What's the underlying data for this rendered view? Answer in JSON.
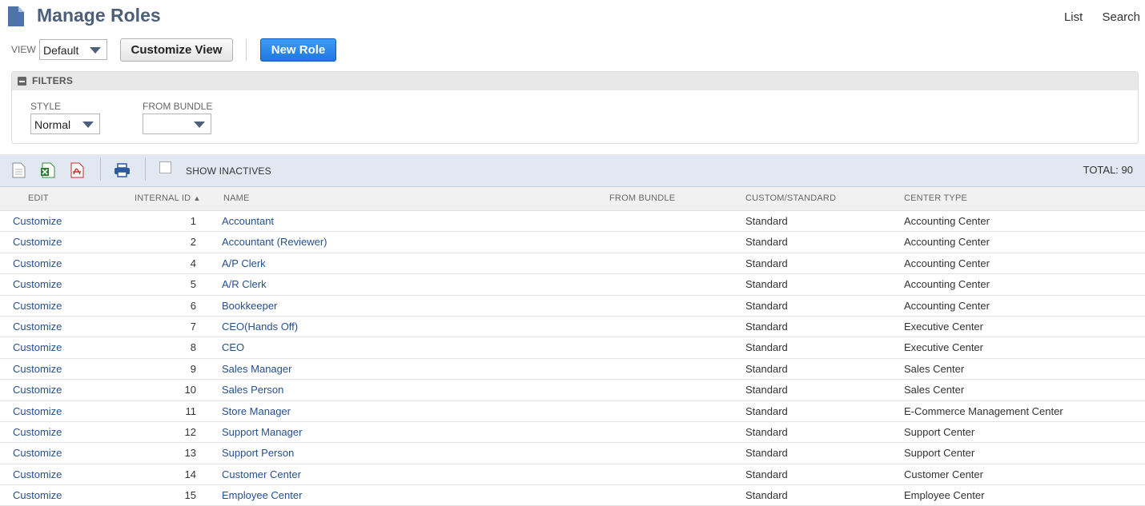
{
  "header": {
    "title": "Manage Roles",
    "links": [
      "List",
      "Search"
    ]
  },
  "controls": {
    "view_label": "VIEW",
    "view_value": "Default",
    "customize_view_label": "Customize View",
    "new_role_label": "New Role"
  },
  "filters": {
    "title": "FILTERS",
    "style_label": "STYLE",
    "style_value": "Normal",
    "from_bundle_label": "FROM BUNDLE",
    "from_bundle_value": ""
  },
  "toolbar": {
    "show_inactives_label": "SHOW INACTIVES",
    "show_inactives_checked": false,
    "total": "TOTAL: 90"
  },
  "table": {
    "headers": {
      "edit": "EDIT",
      "internal_id": "INTERNAL ID",
      "name": "NAME",
      "from_bundle": "FROM BUNDLE",
      "custom_standard": "CUSTOM/STANDARD",
      "center_type": "CENTER TYPE"
    },
    "sort_indicator": "▲",
    "rows": [
      {
        "edit": "Customize",
        "id": "1",
        "name": "Accountant",
        "type": "Standard",
        "center": "Accounting Center"
      },
      {
        "edit": "Customize",
        "id": "2",
        "name": "Accountant (Reviewer)",
        "type": "Standard",
        "center": "Accounting Center"
      },
      {
        "edit": "Customize",
        "id": "4",
        "name": "A/P Clerk",
        "type": "Standard",
        "center": "Accounting Center"
      },
      {
        "edit": "Customize",
        "id": "5",
        "name": "A/R Clerk",
        "type": "Standard",
        "center": "Accounting Center"
      },
      {
        "edit": "Customize",
        "id": "6",
        "name": "Bookkeeper",
        "type": "Standard",
        "center": "Accounting Center"
      },
      {
        "edit": "Customize",
        "id": "7",
        "name": "CEO(Hands Off)",
        "type": "Standard",
        "center": "Executive Center"
      },
      {
        "edit": "Customize",
        "id": "8",
        "name": "CEO",
        "type": "Standard",
        "center": "Executive Center"
      },
      {
        "edit": "Customize",
        "id": "9",
        "name": "Sales Manager",
        "type": "Standard",
        "center": "Sales Center"
      },
      {
        "edit": "Customize",
        "id": "10",
        "name": "Sales Person",
        "type": "Standard",
        "center": "Sales Center"
      },
      {
        "edit": "Customize",
        "id": "11",
        "name": "Store Manager",
        "type": "Standard",
        "center": "E-Commerce Management Center"
      },
      {
        "edit": "Customize",
        "id": "12",
        "name": "Support Manager",
        "type": "Standard",
        "center": "Support Center"
      },
      {
        "edit": "Customize",
        "id": "13",
        "name": "Support Person",
        "type": "Standard",
        "center": "Support Center"
      },
      {
        "edit": "Customize",
        "id": "14",
        "name": "Customer Center",
        "type": "Standard",
        "center": "Customer Center"
      },
      {
        "edit": "Customize",
        "id": "15",
        "name": "Employee Center",
        "type": "Standard",
        "center": "Employee Center"
      }
    ]
  },
  "icons": {
    "page": "document-icon",
    "export_csv": "csv-export-icon",
    "export_excel": "excel-export-icon",
    "export_pdf": "pdf-export-icon",
    "print": "print-icon",
    "collapse": "collapse-icon"
  },
  "colors": {
    "title": "#4d5f79",
    "link": "#26508f",
    "primary_button": "#2a86ea",
    "toolbar_bg": "#e1e8f1"
  }
}
